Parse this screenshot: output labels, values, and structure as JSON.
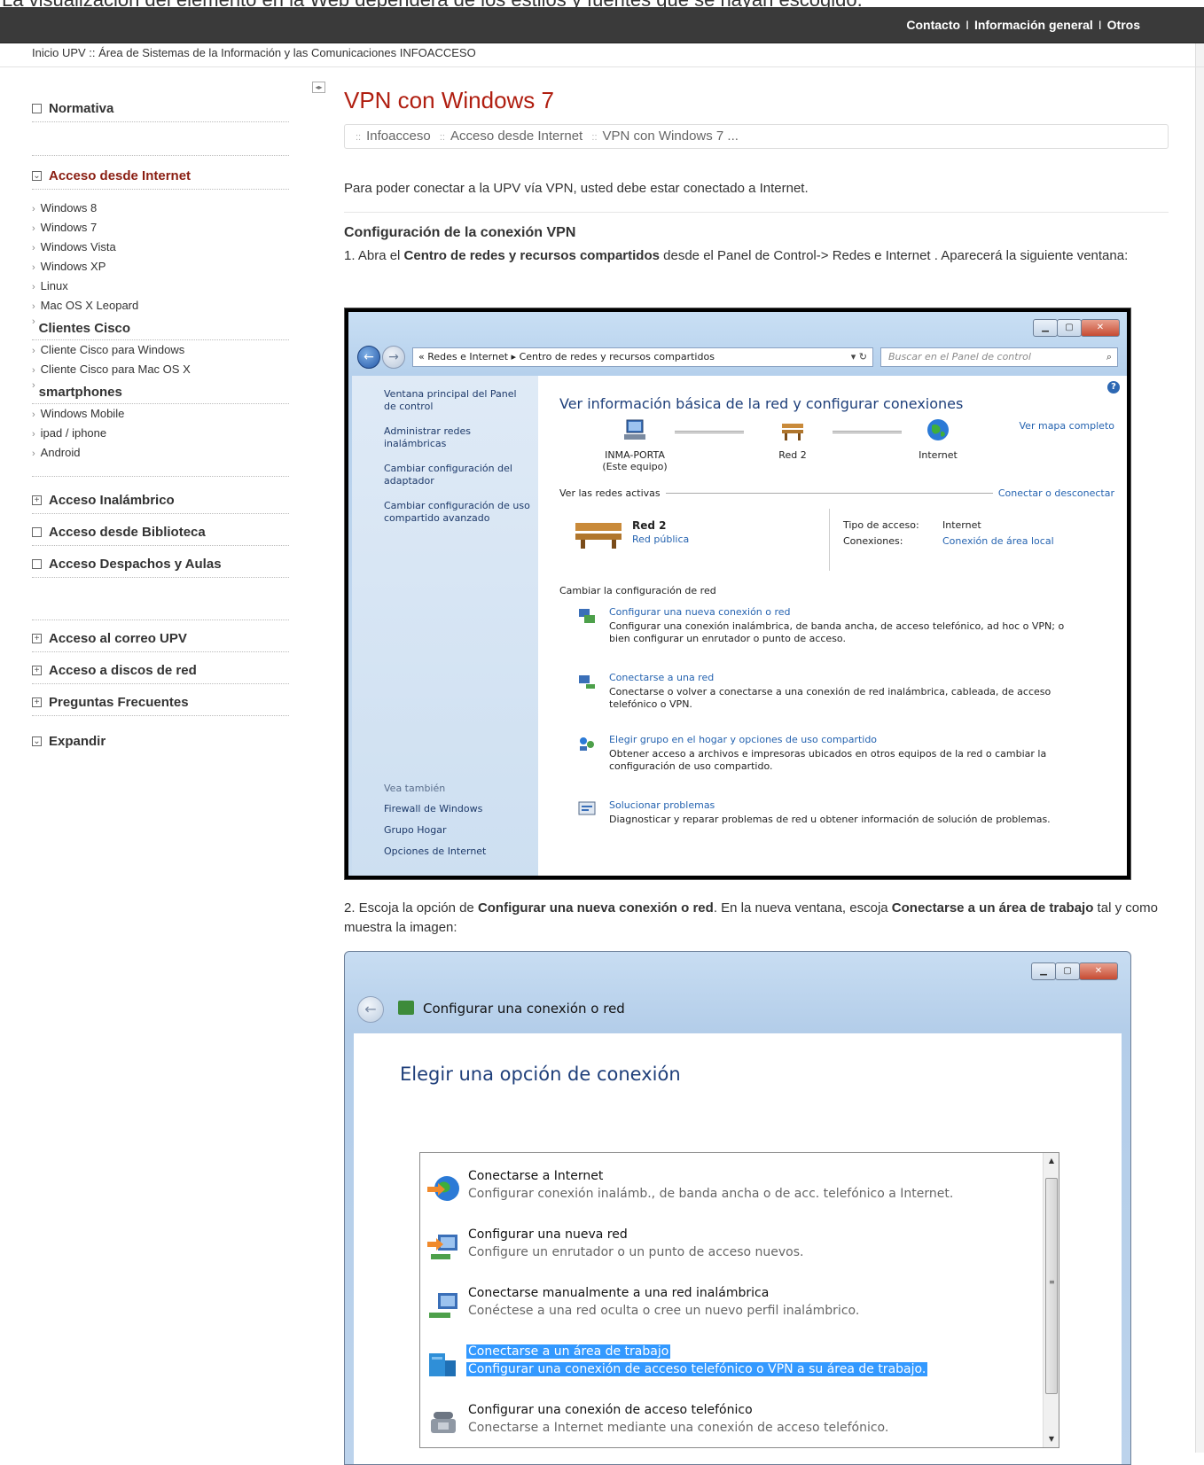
{
  "notice": "La visualización del elemento en la Web dependerá de los estilos y fuentes que se hayan escogido.",
  "topbar": {
    "links": [
      "Contacto",
      "Información general",
      "Otros"
    ],
    "separator": "I"
  },
  "site_crumb": "Inicio UPV :: Área de Sistemas de la Información y las Comunicaciones INFOACCESO",
  "sidebar": {
    "sections": [
      {
        "label": "Normativa",
        "state": "collapsed"
      },
      {
        "label": "Acceso desde Internet",
        "state": "expanded"
      },
      {
        "label": "Acceso Inalámbrico",
        "state": "plus"
      },
      {
        "label": "Acceso desde Biblioteca",
        "state": "collapsed"
      },
      {
        "label": "Acceso Despachos y Aulas",
        "state": "collapsed"
      },
      {
        "label": "Acceso al correo UPV",
        "state": "plus"
      },
      {
        "label": "Acceso a discos de red",
        "state": "plus"
      },
      {
        "label": "Preguntas Frecuentes",
        "state": "plus"
      },
      {
        "label": "Expandir",
        "state": "expanded"
      }
    ],
    "internet_items": [
      "Windows 8",
      "Windows 7",
      "Windows Vista",
      "Windows XP",
      "Linux",
      "Mac OS X Leopard"
    ],
    "cisco_title": "Clientes Cisco",
    "cisco_items": [
      "Cliente Cisco para Windows",
      "Cliente Cisco para Mac OS X"
    ],
    "smart_title": "smartphones",
    "smart_items": [
      "Windows Mobile",
      "ipad / iphone",
      "Android"
    ]
  },
  "main": {
    "title": "VPN con Windows 7",
    "breadcrumb": [
      "Infoacceso",
      "Acceso desde Internet",
      "VPN con Windows 7 ..."
    ],
    "intro": "Para poder conectar a la UPV vía VPN, usted debe estar conectado a Internet.",
    "section_title": "Configuración de la conexión VPN",
    "step1_pre": "1. Abra el ",
    "step1_bold": "Centro de redes y recursos compartidos",
    "step1_post": " desde el Panel de Control-> Redes e Internet . Aparecerá la siguiente ventana:",
    "step2_pre": "2. Escoja la opción de ",
    "step2_bold1": "Configurar una nueva conexión o red",
    "step2_mid": ". En la nueva ventana, escoja ",
    "step2_bold2": "Conectarse a un área de trabajo",
    "step2_post": " tal y como muestra la imagen:"
  },
  "shot1": {
    "address": "« Redes e Internet ▸ Centro de redes y recursos compartidos",
    "search_placeholder": "Buscar en el Panel de control",
    "left_links": [
      "Ventana principal del Panel de control",
      "Administrar redes inalámbricas",
      "Cambiar configuración del adaptador",
      "Cambiar configuración de uso compartido avanzado"
    ],
    "see_also_label": "Vea también",
    "see_also": [
      "Firewall de Windows",
      "Grupo Hogar",
      "Opciones de Internet"
    ],
    "title": "Ver información básica de la red y configurar conexiones",
    "map_link": "Ver mapa completo",
    "nodes": [
      {
        "name": "INMA-PORTA",
        "sub": "(Este equipo)"
      },
      {
        "name": "Red 2",
        "sub": ""
      },
      {
        "name": "Internet",
        "sub": ""
      }
    ],
    "active_label": "Ver las redes activas",
    "connect_link": "Conectar o desconectar",
    "net_name": "Red 2",
    "net_type": "Red pública",
    "access_key": "Tipo de acceso:",
    "access_val": "Internet",
    "conn_key": "Conexiones:",
    "conn_val": "Conexión de área local",
    "change_title": "Cambiar la configuración de red",
    "tasks": [
      {
        "link": "Configurar una nueva conexión o red",
        "desc": "Configurar una conexión inalámbrica, de banda ancha, de acceso telefónico, ad hoc o VPN; o bien configurar un enrutador o punto de acceso."
      },
      {
        "link": "Conectarse a una red",
        "desc": "Conectarse o volver a conectarse a una conexión de red inalámbrica, cableada, de acceso telefónico o VPN."
      },
      {
        "link": "Elegir grupo en el hogar y opciones de uso compartido",
        "desc": "Obtener acceso a archivos e impresoras ubicados en otros equipos de la red o cambiar la configuración de uso compartido."
      },
      {
        "link": "Solucionar problemas",
        "desc": "Diagnosticar y reparar problemas de red u obtener información de solución de problemas."
      }
    ]
  },
  "shot2": {
    "window_title": "Configurar una conexión o red",
    "heading": "Elegir una opción de conexión",
    "options": [
      {
        "title": "Conectarse a Internet",
        "desc": "Configurar conexión inalámb., de banda ancha o de acc. telefónico a Internet.",
        "selected": false
      },
      {
        "title": "Configurar una nueva red",
        "desc": "Configure un enrutador o un punto de acceso nuevos.",
        "selected": false
      },
      {
        "title": "Conectarse manualmente a una red inalámbrica",
        "desc": "Conéctese a una red oculta o cree un nuevo perfil inalámbrico.",
        "selected": false
      },
      {
        "title": "Conectarse a un área de trabajo",
        "desc": "Configurar una conexión de acceso telefónico o VPN a su área de trabajo.",
        "selected": true
      },
      {
        "title": "Configurar una conexión de acceso telefónico",
        "desc": "Conectarse a Internet mediante una conexión de acceso telefónico.",
        "selected": false
      }
    ]
  }
}
